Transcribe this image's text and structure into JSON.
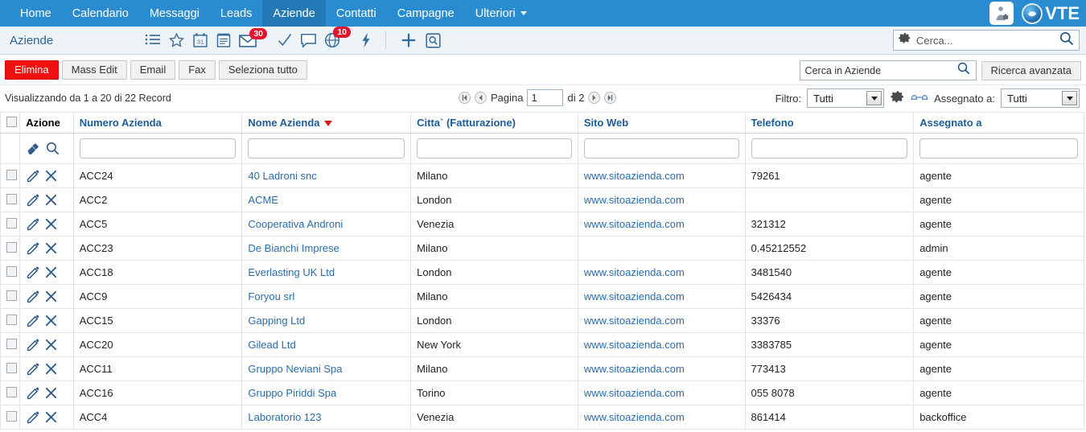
{
  "topnav": {
    "items": [
      {
        "label": "Home",
        "active": false,
        "caret": false
      },
      {
        "label": "Calendario",
        "active": false,
        "caret": false
      },
      {
        "label": "Messaggi",
        "active": false,
        "caret": false
      },
      {
        "label": "Leads",
        "active": false,
        "caret": false
      },
      {
        "label": "Aziende",
        "active": true,
        "caret": false
      },
      {
        "label": "Contatti",
        "active": false,
        "caret": false
      },
      {
        "label": "Campagne",
        "active": false,
        "caret": false
      },
      {
        "label": "Ulteriori",
        "active": false,
        "caret": true
      }
    ],
    "logo_text": "VTE",
    "bg_color": "#2a8cd0",
    "active_color": "#2279b5"
  },
  "toolbar": {
    "module_title": "Aziende",
    "icons": [
      {
        "name": "list-icon",
        "badge": null
      },
      {
        "name": "star-icon",
        "badge": null
      },
      {
        "name": "calendar-icon",
        "badge": null
      },
      {
        "name": "notes-icon",
        "badge": null
      },
      {
        "name": "envelope-icon",
        "badge": "30"
      },
      {
        "name": "checkmark-icon",
        "badge": null
      },
      {
        "name": "chat-icon",
        "badge": null
      },
      {
        "name": "globe-icon",
        "badge": "10"
      },
      {
        "name": "lightning-icon",
        "badge": null
      },
      {
        "name": "plus-icon",
        "badge": null
      },
      {
        "name": "quick-search-icon",
        "badge": null
      }
    ],
    "search_placeholder": "Cerca...",
    "badge_color": "#e8112d"
  },
  "actions": {
    "delete_label": "Elimina",
    "mass_edit_label": "Mass Edit",
    "email_label": "Email",
    "fax_label": "Fax",
    "select_all_label": "Seleziona tutto",
    "module_search_value": "Cerca in Aziende",
    "advanced_search_label": "Ricerca avanzata",
    "delete_color": "#f20f0f"
  },
  "status": {
    "records_text": "Visualizzando da 1 a 20 di 22 Record",
    "page_label": "Pagina",
    "page_value": "1",
    "of_label": "di 2",
    "filter_label": "Filtro:",
    "filter_value": "Tutti",
    "assigned_label": "Assegnato a:",
    "assigned_value": "Tutti"
  },
  "table": {
    "columns": [
      {
        "key": "check",
        "label": ""
      },
      {
        "key": "action",
        "label": "Azione",
        "sorted": false,
        "link": false
      },
      {
        "key": "number",
        "label": "Numero Azienda",
        "sorted": false,
        "link": true
      },
      {
        "key": "name",
        "label": "Nome Azienda",
        "sorted": true,
        "link": true
      },
      {
        "key": "city",
        "label": "Citta` (Fatturazione)",
        "sorted": false,
        "link": true
      },
      {
        "key": "web",
        "label": "Sito Web",
        "sorted": false,
        "link": true
      },
      {
        "key": "phone",
        "label": "Telefono",
        "sorted": false,
        "link": true
      },
      {
        "key": "assigned",
        "label": "Assegnato a",
        "sorted": false,
        "link": true
      }
    ],
    "filter_row": {
      "eraser_icon": "eraser-icon",
      "search_icon": "search-icon",
      "values": [
        "",
        "",
        "",
        "",
        "",
        ""
      ]
    },
    "rows": [
      {
        "number": "ACC24",
        "name": "40 Ladroni snc",
        "city": "Milano",
        "web": "www.sitoazienda.com",
        "phone": "79261",
        "assigned": "agente"
      },
      {
        "number": "ACC2",
        "name": "ACME",
        "city": "London",
        "web": "www.sitoazienda.com",
        "phone": "",
        "assigned": "agente"
      },
      {
        "number": "ACC5",
        "name": "Cooperativa Androni",
        "city": "Venezia",
        "web": "www.sitoazienda.com",
        "phone": "321312",
        "assigned": "agente"
      },
      {
        "number": "ACC23",
        "name": "De Bianchi Imprese",
        "city": "Milano",
        "web": "",
        "phone": "0.45212552",
        "assigned": "admin"
      },
      {
        "number": "ACC18",
        "name": "Everlasting UK Ltd",
        "city": "London",
        "web": "www.sitoazienda.com",
        "phone": "3481540",
        "assigned": "agente"
      },
      {
        "number": "ACC9",
        "name": "Foryou srl",
        "city": "Milano",
        "web": "www.sitoazienda.com",
        "phone": "5426434",
        "assigned": "agente"
      },
      {
        "number": "ACC15",
        "name": "Gapping Ltd",
        "city": "London",
        "web": "www.sitoazienda.com",
        "phone": "33376",
        "assigned": "agente"
      },
      {
        "number": "ACC20",
        "name": "Gilead Ltd",
        "city": "New York",
        "web": "www.sitoazienda.com",
        "phone": "3383785",
        "assigned": "agente"
      },
      {
        "number": "ACC11",
        "name": "Gruppo Neviani Spa",
        "city": "Milano",
        "web": "www.sitoazienda.com",
        "phone": "773413",
        "assigned": "agente"
      },
      {
        "number": "ACC16",
        "name": "Gruppo Piriddi Spa",
        "city": "Torino",
        "web": "www.sitoazienda.com",
        "phone": "055 8078",
        "assigned": "agente"
      },
      {
        "number": "ACC4",
        "name": "Laboratorio 123",
        "city": "Venezia",
        "web": "www.sitoazienda.com",
        "phone": "861414",
        "assigned": "backoffice"
      }
    ]
  }
}
